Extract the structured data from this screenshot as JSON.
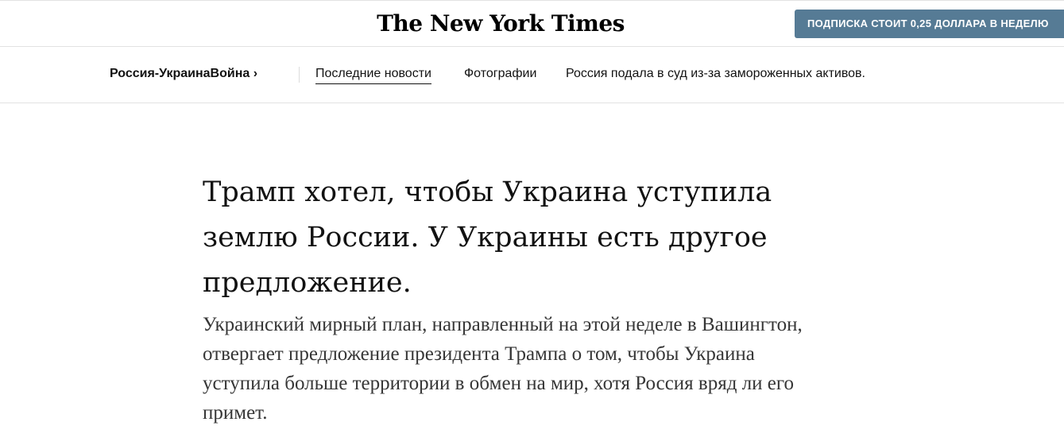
{
  "header": {
    "logo_text": "The New York Times",
    "subscribe_label": "ПОДПИСКА СТОИТ 0,25 ДОЛЛАРА В НЕДЕЛЮ"
  },
  "section_nav": {
    "section_label": "Россия-УкраинаВойна ›",
    "links": [
      {
        "label": "Последние новости",
        "active": true
      },
      {
        "label": "Фотографии",
        "active": false
      },
      {
        "label": "Россия подала в суд из-за замороженных активов.",
        "active": false
      }
    ]
  },
  "article": {
    "headline": "Трамп хотел, чтобы Украина уступила землю России. У Украины есть другое предложение.",
    "summary": "Украинский мирный план, направленный на этой неделе в Вашингтон, отвергает предложение президента Трампа о том, чтобы Украина уступила больше территории в обмен на мир, хотя Россия вряд ли его примет."
  }
}
